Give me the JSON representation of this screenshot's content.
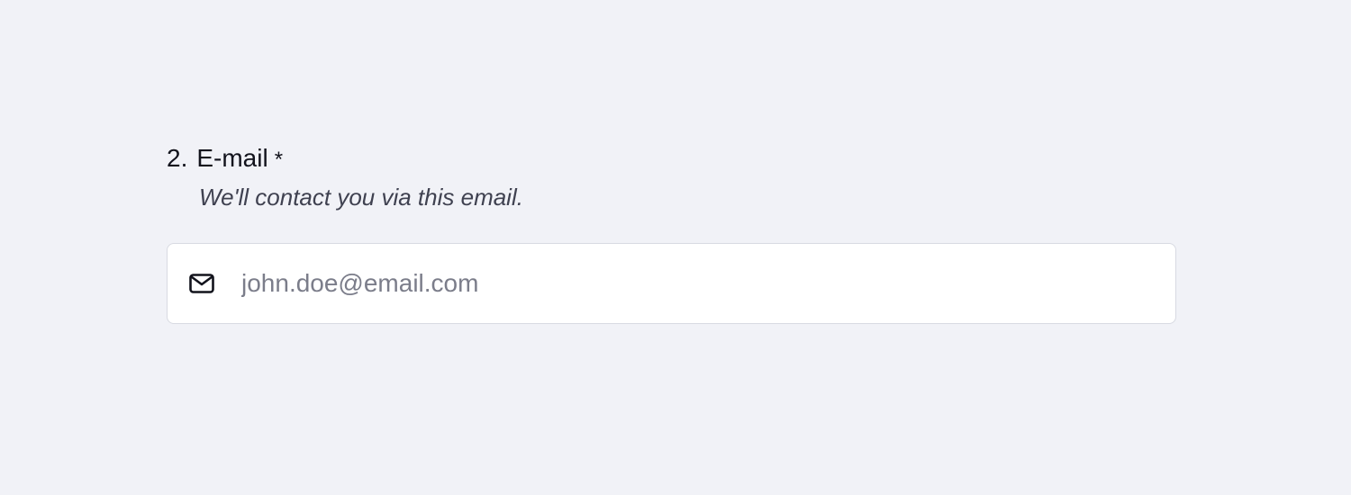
{
  "question": {
    "number": "2.",
    "title": "E-mail",
    "required_mark": "*",
    "hint": "We'll contact you via this email."
  },
  "email_field": {
    "icon": "mail-icon",
    "value": "",
    "placeholder": "john.doe@email.com"
  },
  "colors": {
    "background": "#f1f2f7",
    "field_background": "#ffffff",
    "field_border": "#d8dae2",
    "text": "#12131c",
    "hint_text": "#3f4150",
    "placeholder_text": "#7b7d8a"
  }
}
